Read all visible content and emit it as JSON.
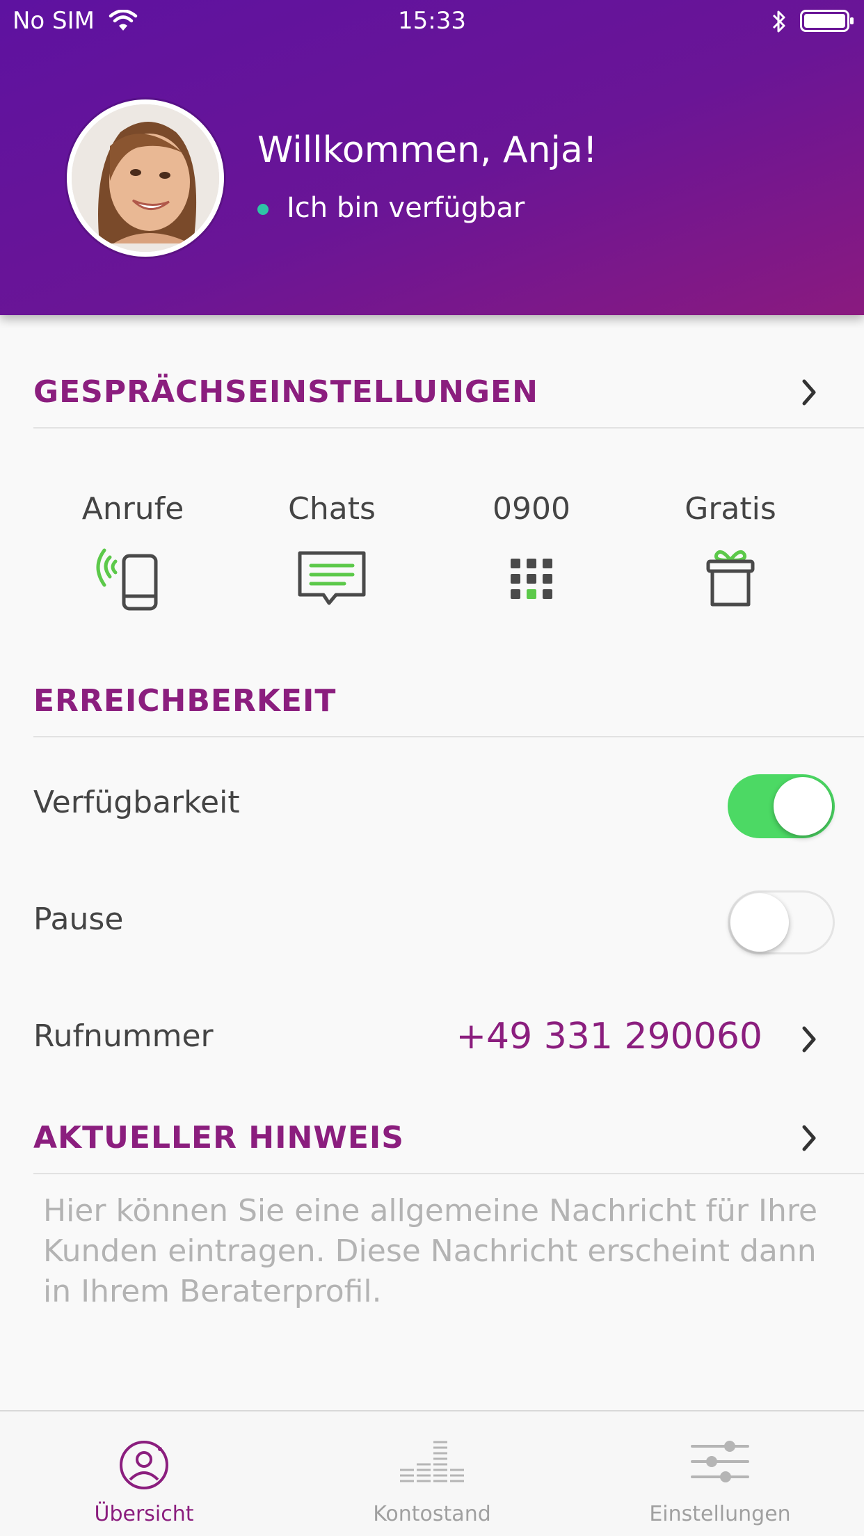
{
  "status_bar": {
    "carrier": "No SIM",
    "time": "15:33"
  },
  "header": {
    "welcome": "Willkommen, Anja!",
    "availability_status": "Ich bin verfügbar",
    "status_color": "#2ec4a6"
  },
  "call_settings": {
    "title": "GESPRÄCHSEINSTELLUNGEN",
    "options": [
      {
        "label": "Anrufe",
        "icon": "phone-calling-icon"
      },
      {
        "label": "Chats",
        "icon": "chat-bubble-icon"
      },
      {
        "label": "0900",
        "icon": "keypad-icon"
      },
      {
        "label": "Gratis",
        "icon": "gift-icon"
      }
    ]
  },
  "reachability": {
    "title": "ERREICHBERKEIT",
    "availability_label": "Verfügbarkeit",
    "availability_on": true,
    "pause_label": "Pause",
    "pause_on": false,
    "phone_label": "Rufnummer",
    "phone_value": "+49 331 290060"
  },
  "current_notice": {
    "title": "AKTUELLER HINWEIS",
    "placeholder": "Hier können Sie eine allgemeine Nachricht für Ihre Kunden eintragen. Diese Nachricht erscheint dann in Ihrem Beraterprofil."
  },
  "tab_bar": {
    "tabs": [
      {
        "label": "Übersicht",
        "icon": "user-circle-icon",
        "active": true
      },
      {
        "label": "Kontostand",
        "icon": "bars-icon",
        "active": false
      },
      {
        "label": "Einstellungen",
        "icon": "sliders-icon",
        "active": false
      }
    ]
  },
  "colors": {
    "brand_purple": "#8b1e7e",
    "header_gradient_start": "#5e12a0",
    "accent_green": "#4cd964",
    "icon_green": "#5cc94a"
  }
}
